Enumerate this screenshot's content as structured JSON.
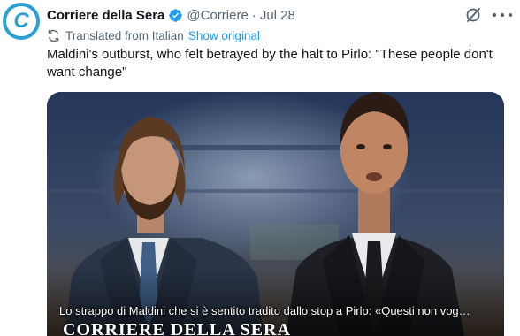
{
  "account": {
    "name": "Corriere della Sera",
    "handle": "@Corriere",
    "separator": "·",
    "date": "Jul 28",
    "avatar_letter": "C",
    "avatar_color": "#2a9fd8",
    "verified_color": "#1d9bf0"
  },
  "translation": {
    "label": "Translated from Italian",
    "show_original": "Show original"
  },
  "tweet": {
    "text": "Maldini's outburst, who felt betrayed by the halt to Pirlo: \"These people don't want change\""
  },
  "media": {
    "caption": "Lo strappo di Maldini che si è sentito tradito dallo stop a Pirlo: «Questi non vog…",
    "watermark": "CORRIERE DELLA SERA"
  },
  "icons": {
    "grok": "grok-slash-circle-icon",
    "more": "more-dots-icon",
    "translate": "translate-icon",
    "verified": "verified-badge-icon"
  }
}
